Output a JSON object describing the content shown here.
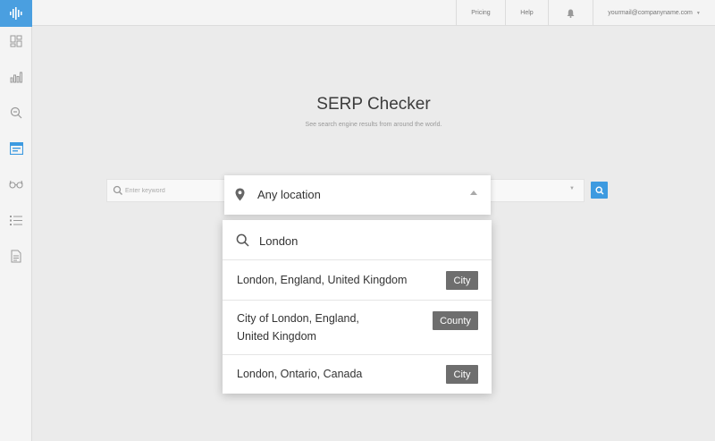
{
  "topbar": {
    "pricing": "Pricing",
    "help": "Help",
    "account": "yourmail@companyname.com"
  },
  "sidebar": {
    "items": [
      {
        "icon": "dashboard-icon"
      },
      {
        "icon": "bar-chart-icon"
      },
      {
        "icon": "search-magnifier-icon"
      },
      {
        "icon": "serp-checker-icon",
        "active": true
      },
      {
        "icon": "glasses-icon"
      },
      {
        "icon": "list-icon"
      },
      {
        "icon": "document-icon"
      }
    ]
  },
  "page": {
    "title": "SERP Checker",
    "subtitle": "See search engine results from around the world."
  },
  "search": {
    "keyword_placeholder": "Enter keyword",
    "location_value": "Any location"
  },
  "dropdown": {
    "query": "London",
    "options": [
      {
        "label": "London, England, United Kingdom",
        "type": "City"
      },
      {
        "label_line1": "City of London, England,",
        "label_line2": "United Kingdom",
        "type": "County"
      },
      {
        "label": "London, Ontario, Canada",
        "type": "City"
      }
    ]
  },
  "colors": {
    "accent": "#3d9ae0",
    "badge": "#6e6e6e",
    "background": "#ebebeb"
  }
}
